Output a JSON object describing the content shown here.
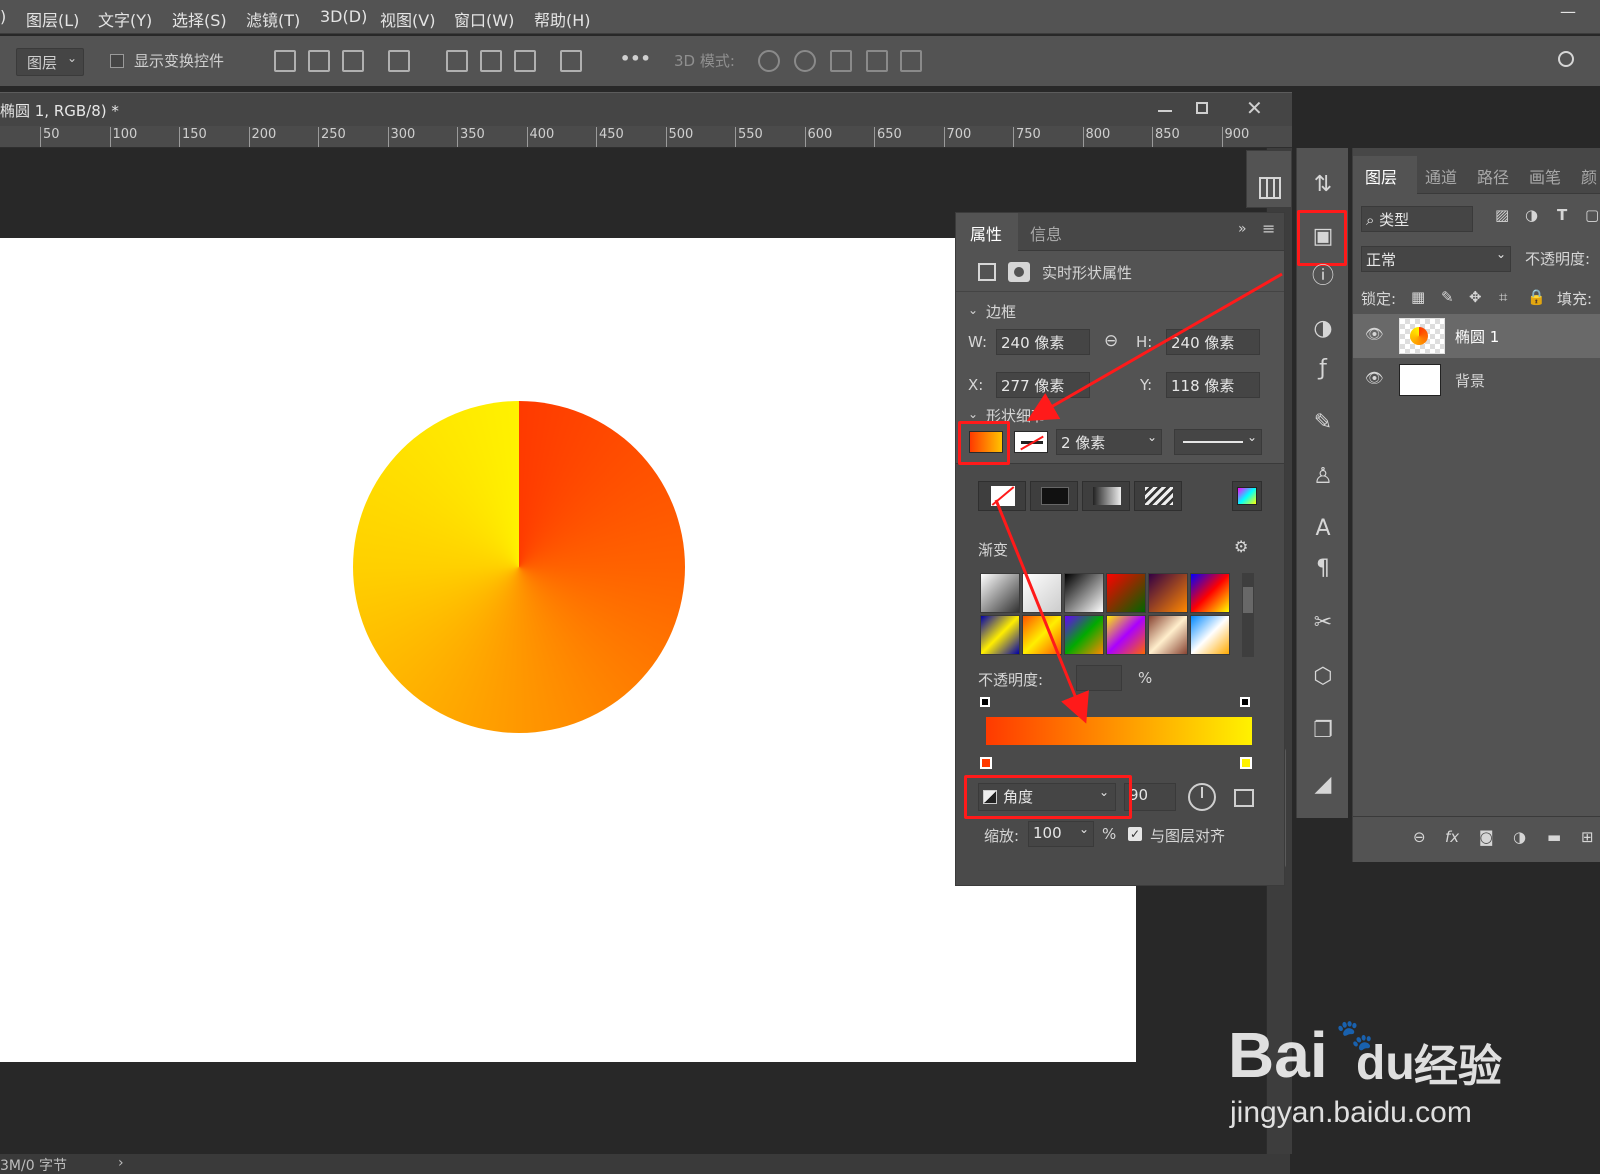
{
  "menubar": {
    "items": [
      "图层(L)",
      "文字(Y)",
      "选择(S)",
      "滤镜(T)",
      "3D(D)",
      "视图(V)",
      "窗口(W)",
      "帮助(H)"
    ],
    "minimize": "—"
  },
  "options": {
    "layer_select": "图层",
    "show_transform_label": "显示变换控件",
    "more": "•••",
    "mode_3d_label": "3D 模式:"
  },
  "document": {
    "tab_title": "椭圆 1, RGB/8) *",
    "ruler_ticks": [
      "50",
      "100",
      "150",
      "200",
      "250",
      "300",
      "350",
      "400",
      "450",
      "500",
      "550",
      "600",
      "650",
      "700",
      "750",
      "800",
      "850",
      "900"
    ],
    "status": "3M/0 字节"
  },
  "properties": {
    "tab_properties": "属性",
    "tab_info": "信息",
    "heading": "实时形状属性",
    "section_border": "边框",
    "w_label": "W:",
    "w_value": "240 像素",
    "h_label": "H:",
    "h_value": "240 像素",
    "x_label": "X:",
    "x_value": "277 像素",
    "y_label": "Y:",
    "y_value": "118 像素",
    "section_shape": "形状细节",
    "stroke_width": "2 像素",
    "gradient_label": "渐变",
    "opacity_label": "不透明度:",
    "opacity_unit": "%",
    "gradient_type": "角度",
    "angle_value": "90",
    "scale_label": "缩放:",
    "scale_value": "100",
    "scale_unit": "%",
    "align_label": "与图层对齐"
  },
  "layers_panel": {
    "tabs": [
      "图层",
      "通道",
      "路径",
      "画笔",
      "颜"
    ],
    "filter_label": "类型",
    "blend_mode": "正常",
    "opacity_label": "不透明度:",
    "lock_label": "锁定:",
    "fill_label": "填充:",
    "layers": [
      {
        "name": "椭圆 1"
      },
      {
        "name": "背景"
      }
    ]
  },
  "watermark": {
    "brand": "Bai",
    "brand2": "du",
    "suffix": "经验",
    "url": "jingyan.baidu.com"
  },
  "colors": {
    "accent_red": "#ff1a1a",
    "gradient_start": "#ff3a00",
    "gradient_end": "#fff200"
  }
}
